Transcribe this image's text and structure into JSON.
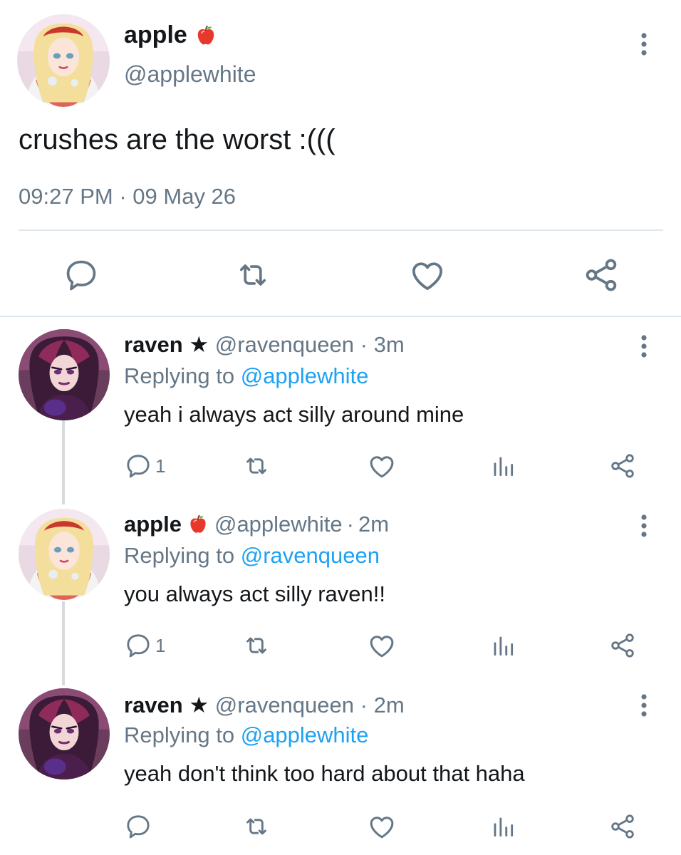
{
  "main_tweet": {
    "name": "apple",
    "name_emoji": "apple-emoji",
    "handle": "@applewhite",
    "text": "crushes are the worst :(((",
    "time": "09:27 PM",
    "separator": "·",
    "date": "09 May 26"
  },
  "replies": [
    {
      "name": "raven",
      "badge": "★",
      "handle": "@ravenqueen",
      "separator": "·",
      "age": "3m",
      "replying_prefix": "Replying to",
      "replying_to": "@applewhite",
      "text": "yeah i always act silly around mine",
      "reply_count": "1"
    },
    {
      "name": "apple",
      "badge": "apple-emoji",
      "handle": "@applewhite",
      "separator": "·",
      "age": "2m",
      "replying_prefix": "Replying to",
      "replying_to": "@ravenqueen",
      "text": "you always act silly raven!!",
      "reply_count": "1"
    },
    {
      "name": "raven",
      "badge": "★",
      "handle": "@ravenqueen",
      "separator": "·",
      "age": "2m",
      "replying_prefix": "Replying to",
      "replying_to": "@applewhite",
      "text": "yeah don't think too hard about that haha",
      "reply_count": ""
    }
  ],
  "colors": {
    "text": "#14171a",
    "muted": "#657786",
    "link": "#1da1f2",
    "divider": "#e1e8ed"
  },
  "icons": [
    "more-vert-icon",
    "reply-icon",
    "retweet-icon",
    "like-icon",
    "share-icon",
    "analytics-icon"
  ]
}
